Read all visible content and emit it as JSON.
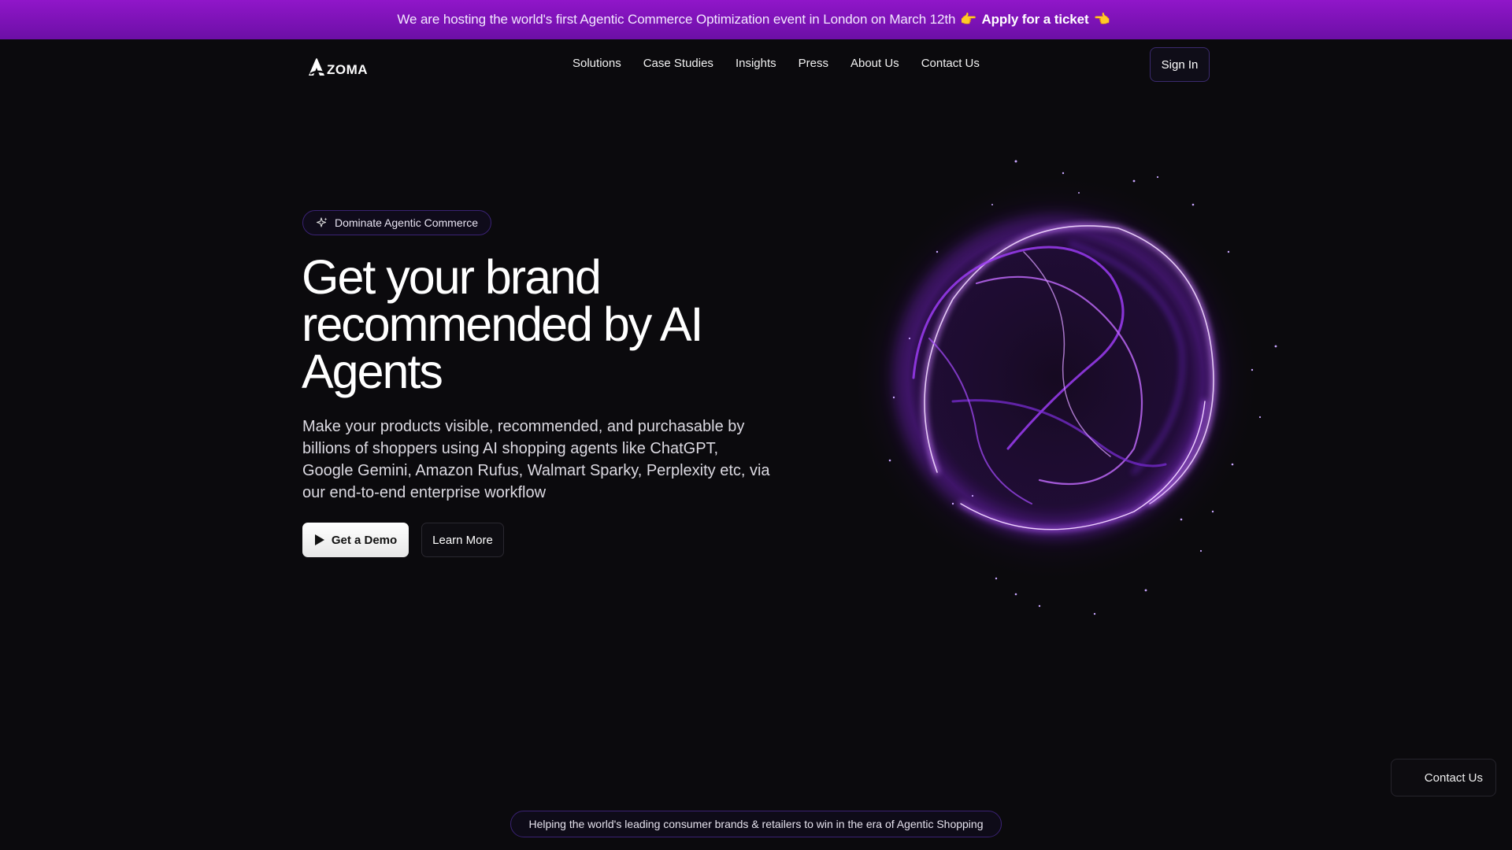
{
  "announcement": {
    "text": "We are hosting the world's first Agentic Commerce Optimization event in London on March 12th",
    "emoji_left": "👉",
    "cta": "Apply for a ticket",
    "emoji_right": "👈"
  },
  "nav": {
    "logo_text": "ZOMA",
    "links": [
      "Solutions",
      "Case Studies",
      "Insights",
      "Press",
      "About Us",
      "Contact Us"
    ],
    "signin": "Sign In"
  },
  "hero": {
    "badge": "Dominate Agentic Commerce",
    "headline_lines": [
      "Get your brand",
      "recommended by AI",
      "Agents"
    ],
    "sub_lines": [
      "Make your products visible, recommended, and purchasable by",
      "billions of shoppers using AI shopping agents like ChatGPT,",
      "Google Gemini, Amazon Rufus, Walmart Sparky, Perplexity etc, via",
      "our end-to-end enterprise workflow"
    ],
    "primary_button": "Get a Demo",
    "secondary_button": "Learn More"
  },
  "floating": {
    "contact": "Contact Us"
  },
  "footer": {
    "pill": "Helping the world's leading consumer brands & retailers to win in the era of Agentic Shopping"
  },
  "colors": {
    "accent": "#8a14c4",
    "background": "#0b0a0d",
    "orb": "#a335ff"
  }
}
